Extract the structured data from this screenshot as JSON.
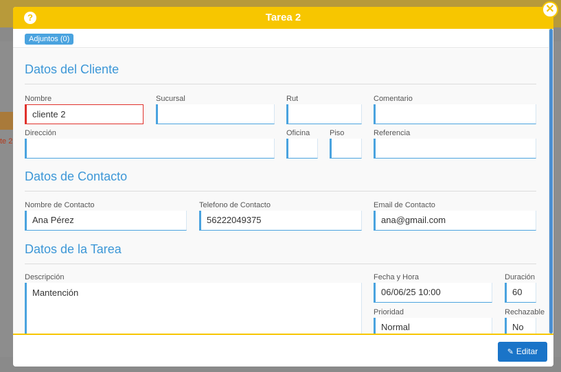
{
  "modal": {
    "title": "Tarea 2",
    "help_icon": "?",
    "close_icon": "✕",
    "attachments_label": "Adjuntos (0)"
  },
  "sections": {
    "client": "Datos del Cliente",
    "contact": "Datos de Contacto",
    "task": "Datos de la Tarea"
  },
  "client": {
    "nombre": {
      "label": "Nombre",
      "value": "cliente 2"
    },
    "sucursal": {
      "label": "Sucursal",
      "value": ""
    },
    "rut": {
      "label": "Rut",
      "value": ""
    },
    "comentario": {
      "label": "Comentario",
      "value": ""
    },
    "direccion": {
      "label": "Dirección",
      "value": ""
    },
    "oficina": {
      "label": "Oficina",
      "value": ""
    },
    "piso": {
      "label": "Piso",
      "value": ""
    },
    "referencia": {
      "label": "Referencia",
      "value": ""
    }
  },
  "contact": {
    "nombre": {
      "label": "Nombre de Contacto",
      "value": "Ana Pérez"
    },
    "telefono": {
      "label": "Telefono de Contacto",
      "value": "56222049375"
    },
    "email": {
      "label": "Email de Contacto",
      "value": "ana@gmail.com"
    }
  },
  "task": {
    "descripcion": {
      "label": "Descripción",
      "value": "Mantención"
    },
    "fecha": {
      "label": "Fecha y Hora",
      "value": "06/06/25 10:00"
    },
    "duracion": {
      "label": "Duración",
      "value": "60"
    },
    "prioridad": {
      "label": "Prioridad",
      "value": "Normal"
    },
    "rechazable": {
      "label": "Rechazable",
      "value": "No"
    }
  },
  "footer": {
    "edit_label": "Editar"
  },
  "background": {
    "red_text": "te 2"
  },
  "colors": {
    "accent": "#f7c600",
    "primary": "#1a74c8",
    "section": "#3c97d7",
    "error": "#e0302a"
  }
}
